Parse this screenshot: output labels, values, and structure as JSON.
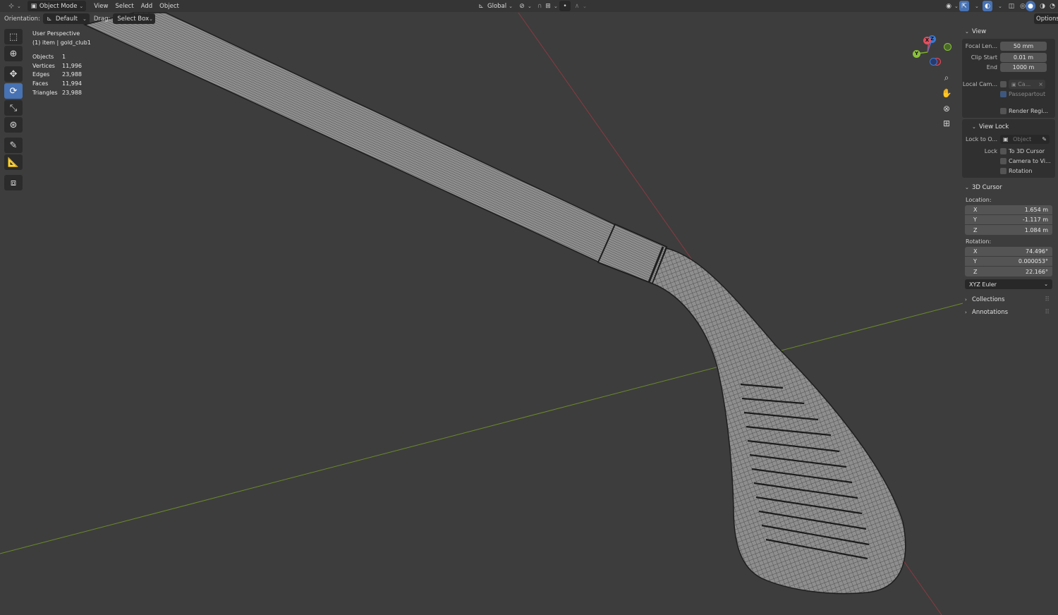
{
  "header": {
    "mode": "Object Mode",
    "menus": [
      "View",
      "Select",
      "Add",
      "Object"
    ],
    "transform_orientation": "Global",
    "options_label": "Options"
  },
  "toolbar_row": {
    "orientation_label": "Orientation:",
    "orientation_value": "Default",
    "drag_label": "Drag:",
    "drag_value": "Select Box"
  },
  "tools": [
    "select-box-icon",
    "cursor-icon",
    "move-icon",
    "rotate-icon",
    "scale-icon",
    "transform-icon",
    "annotate-icon",
    "measure-icon",
    "add-cube-icon"
  ],
  "active_tool": "rotate-icon",
  "overlay": {
    "view_name": "User Perspective",
    "selection": "(1) item | gold_club1",
    "stats": [
      {
        "key": "Objects",
        "value": "1"
      },
      {
        "key": "Vertices",
        "value": "11,996"
      },
      {
        "key": "Edges",
        "value": "23,988"
      },
      {
        "key": "Faces",
        "value": "11,994"
      },
      {
        "key": "Triangles",
        "value": "23,988"
      }
    ]
  },
  "gizmo": {
    "x": "X",
    "y": "Y",
    "z": "Z"
  },
  "npanel": {
    "view": {
      "title": "View",
      "focal_label": "Focal Len...",
      "focal_value": "50 mm",
      "clip_start_label": "Clip Start",
      "clip_start_value": "0.01 m",
      "end_label": "End",
      "end_value": "1000 m",
      "local_cam_label": "Local Cam...",
      "local_cam_value": "Ca...",
      "passepartout_label": "Passepartout",
      "render_region_label": "Render Regi..."
    },
    "view_lock": {
      "title": "View Lock",
      "lock_to_label": "Lock to O...",
      "lock_to_placeholder": "Object",
      "lock_label": "Lock",
      "to_cursor_label": "To 3D Cursor",
      "camera_to_view_label": "Camera to Vi...",
      "rotation_label": "Rotation"
    },
    "cursor": {
      "title": "3D Cursor",
      "location_label": "Location:",
      "location": [
        {
          "axis": "X",
          "value": "1.654 m"
        },
        {
          "axis": "Y",
          "value": "-1.117 m"
        },
        {
          "axis": "Z",
          "value": "1.084 m"
        }
      ],
      "rotation_label": "Rotation:",
      "rotation": [
        {
          "axis": "X",
          "value": "74.496°"
        },
        {
          "axis": "Y",
          "value": "0.000053°"
        },
        {
          "axis": "Z",
          "value": "22.166°"
        }
      ],
      "rotation_mode": "XYZ Euler"
    },
    "collections_title": "Collections",
    "annotations_title": "Annotations"
  },
  "colors": {
    "viewport_bg": "#3d3d3d",
    "x_axis": "#8a3a42",
    "y_axis": "#6b8a2a",
    "accent": "#4772b3",
    "mesh_fill": "#7e7e7e",
    "wire": "#2a2a2a"
  }
}
